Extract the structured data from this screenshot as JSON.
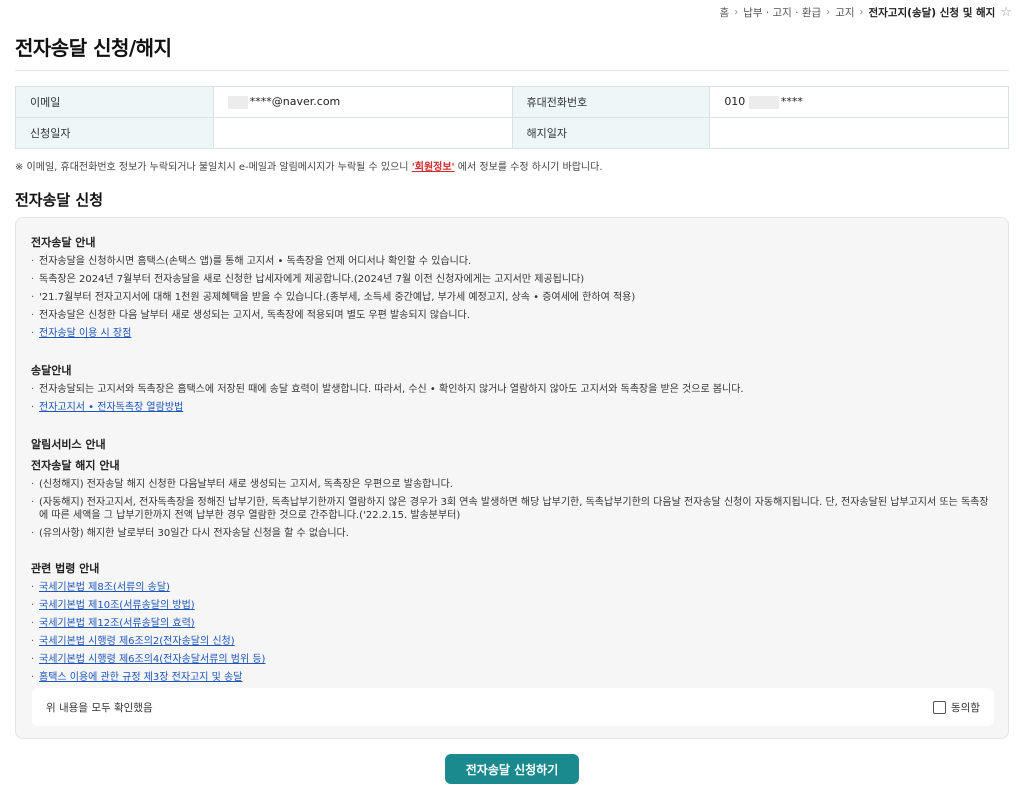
{
  "breadcrumb": {
    "items": [
      "홈",
      "납부 · 고지 · 환급",
      "고지"
    ],
    "current": "전자고지(송달) 신청 및 해지"
  },
  "page_title": "전자송달 신청/해지",
  "info": {
    "email_label": "이메일",
    "email_value": "****@naver.com",
    "phone_label": "휴대전화번호",
    "phone_prefix": "010",
    "phone_suffix": "****",
    "apply_date_label": "신청일자",
    "apply_date_value": "",
    "cancel_date_label": "해지일자",
    "cancel_date_value": ""
  },
  "notice": {
    "text_before": "※ 이메일, 휴대전화번호 정보가 누락되거나 불일치시 e-메일과 알림메시지가 누락될 수 있으니 ",
    "link": "'회원정보'",
    "text_after": " 에서 정보를 수정 하시기 바랍니다.",
    "link_color": "#d12a2a"
  },
  "section_title": "전자송달 신청",
  "guide": {
    "intro_title": "전자송달 안내",
    "intro_items": [
      "전자송달을 신청하시면 홈택스(손택스 앱)를 통해 고지서 • 독촉장을 언제 어디서나 확인할 수 있습니다.",
      "독촉장은 2024년 7월부터 전자송달을 새로 신청한 납세자에게 제공합니다.(2024년 7월 이전 신청자에게는 고지서만 제공됩니다)",
      "'21.7월부터 전자고지서에 대해 1천원 공제혜택을 받을 수 있습니다.(종부세, 소득세 중간예납, 부가세 예정고지, 상속 • 증여세에 한하여 적용)",
      "전자송달은 신청한 다음 날부터 새로 생성되는 고지서, 독촉장에 적용되며 별도 우편 발송되지 않습니다."
    ],
    "intro_link": "전자송달 이용 시 장점",
    "delivery_title": "송달안내",
    "delivery_items": [
      "전자송달되는 고지서와 독촉장은 홈택스에 저장된 때에 송달 효력이 발생합니다. 따라서, 수신 • 확인하지 않거나 열람하지 않아도 고지서와 독촉장을 받은 것으로 봅니다."
    ],
    "delivery_link": "전자고지서 • 전자독촉장 열람방법",
    "alarm_title": "알림서비스 안내",
    "cancel_title": "전자송달 해지 안내",
    "cancel_items": [
      "(신청해지) 전자송달 해지 신청한 다음날부터 새로 생성되는 고지서, 독촉장은 우편으로 발송합니다.",
      "(자동해지) 전자고지서, 전자독촉장을 정해진 납부기한, 독촉납부기한까지 열람하지 않은 경우가 3회 연속 발생하면 해당 납부기한, 독촉납부기한의 다음날 전자송달 신청이 자동해지됩니다. 단, 전자송달된 납부고지서 또는 독촉장에 따른 세액을 그 납부기한까지 전액 납부한 경우 열람한 것으로 간주합니다.('22.2.15. 발송분부터)",
      "(유의사항) 해지한 날로부터 30일간 다시 전자송달 신청을 할 수 없습니다."
    ],
    "law_title": "관련 법령 안내",
    "law_links": [
      "국세기본법 제8조(서류의 송달)",
      "국세기본법 제10조(서류송달의 방법)",
      "국세기본법 제12조(서류송달의 효력)",
      "국세기본법 시행령 제6조의2(전자송달의 신청)",
      "국세기본법 시행령 제6조의4(전자송달서류의 범위 등)",
      "홈택스 이용에 관한 규정 제3장 전자고지 및 송달"
    ]
  },
  "confirm": {
    "text": "위 내용을 모두 확인했음",
    "agree_label": "동의함"
  },
  "submit_label": "전자송달 신청하기",
  "colors": {
    "accent": "#1b8a8f",
    "header_cell": "#eef7f7",
    "link": "#1d55b8"
  }
}
